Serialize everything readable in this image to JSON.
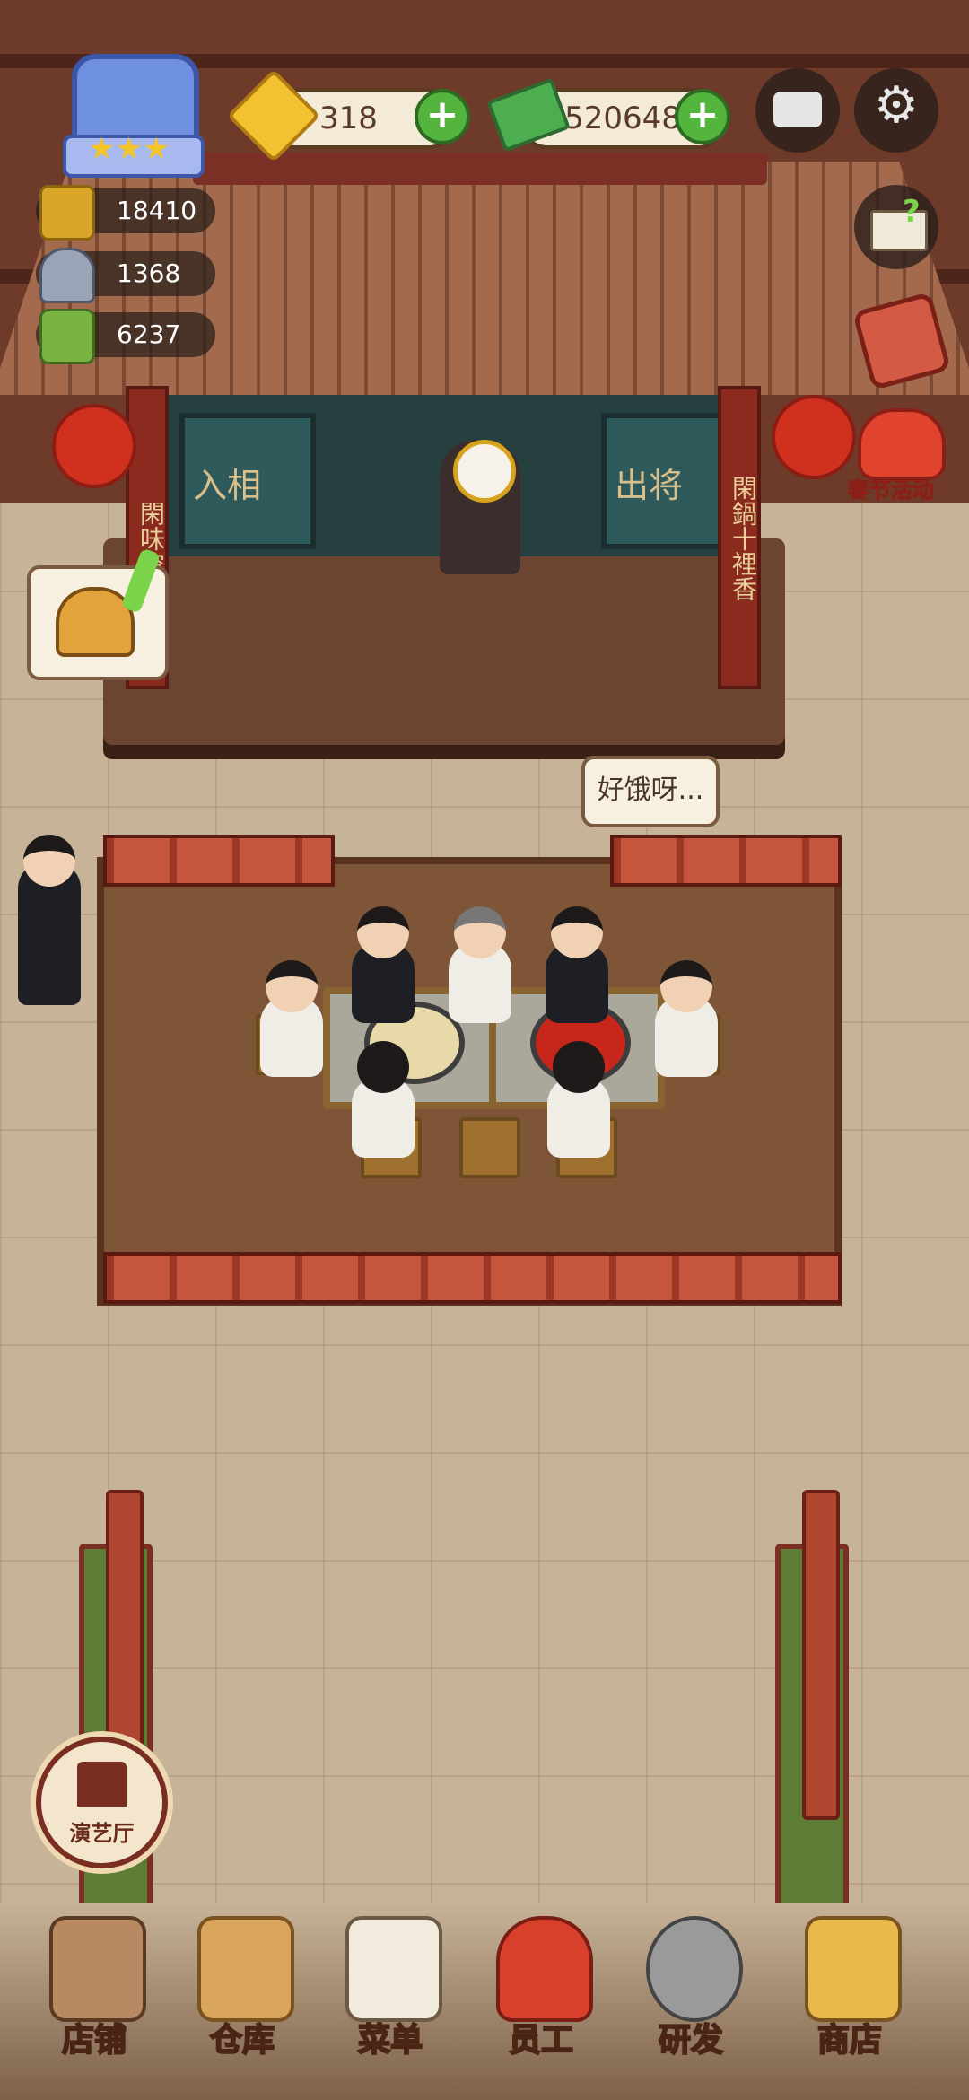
{
  "hud": {
    "gems": "318",
    "cash": "520648",
    "stats": [
      {
        "icon": "gold-ingot-icon",
        "value": "18410"
      },
      {
        "icon": "service-dish-icon",
        "value": "1368"
      },
      {
        "icon": "recipe-book-icon",
        "value": "6237"
      }
    ],
    "event_label": "春节活动"
  },
  "stage": {
    "couplet_left": "閑味空",
    "couplet_right": "閑鍋十裡香",
    "curtain_left": "入相",
    "curtain_right": "出将"
  },
  "speech": {
    "customer_bubble": "好饿呀..."
  },
  "hall_button": {
    "label": "演艺厅"
  },
  "nav": [
    {
      "icon": "shop-building-icon",
      "label": "店铺"
    },
    {
      "icon": "warehouse-boxes-icon",
      "label": "仓库"
    },
    {
      "icon": "menu-clipboard-icon",
      "label": "菜单"
    },
    {
      "icon": "staff-icon",
      "label": "员工"
    },
    {
      "icon": "research-wok-icon",
      "label": "研发"
    },
    {
      "icon": "store-icon",
      "label": "商店"
    }
  ],
  "colors": {
    "accent_green": "#53b43e",
    "nav_text_stroke": "#4a2516",
    "event_text": "#ffe06b"
  }
}
